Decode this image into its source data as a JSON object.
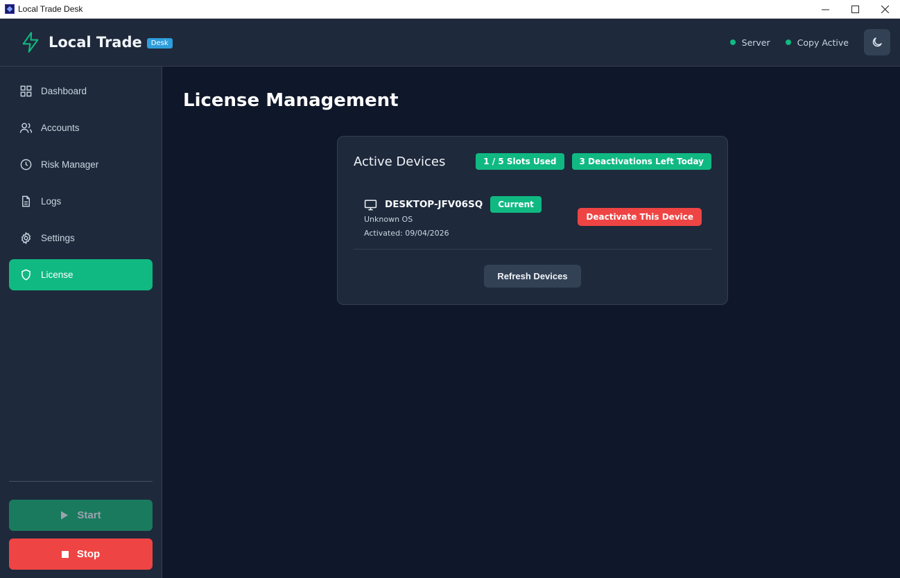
{
  "window": {
    "title": "Local Trade Desk",
    "minimize": "—",
    "maximize": "☐",
    "close": "✕"
  },
  "header": {
    "brand": "Local Trade",
    "brand_badge": "Desk",
    "status_server": "Server",
    "status_copy": "Copy Active",
    "accent_color": "#10b981"
  },
  "sidebar": {
    "items": [
      {
        "label": "Dashboard",
        "icon": "grid-icon"
      },
      {
        "label": "Accounts",
        "icon": "users-icon"
      },
      {
        "label": "Risk Manager",
        "icon": "clock-icon"
      },
      {
        "label": "Logs",
        "icon": "file-icon"
      },
      {
        "label": "Settings",
        "icon": "gear-icon"
      },
      {
        "label": "License",
        "icon": "shield-icon",
        "active": true
      }
    ],
    "start_label": "Start",
    "stop_label": "Stop"
  },
  "main": {
    "title": "License Management",
    "card": {
      "title": "Active Devices",
      "slots_badge": "1 / 5 Slots Used",
      "deactivations_badge": "3 Deactivations Left Today",
      "device": {
        "name": "DESKTOP-JFV06SQ",
        "current_badge": "Current",
        "os": "Unknown OS",
        "activated": "Activated: 09/04/2026",
        "deactivate_label": "Deactivate This Device"
      },
      "refresh_label": "Refresh Devices"
    }
  }
}
